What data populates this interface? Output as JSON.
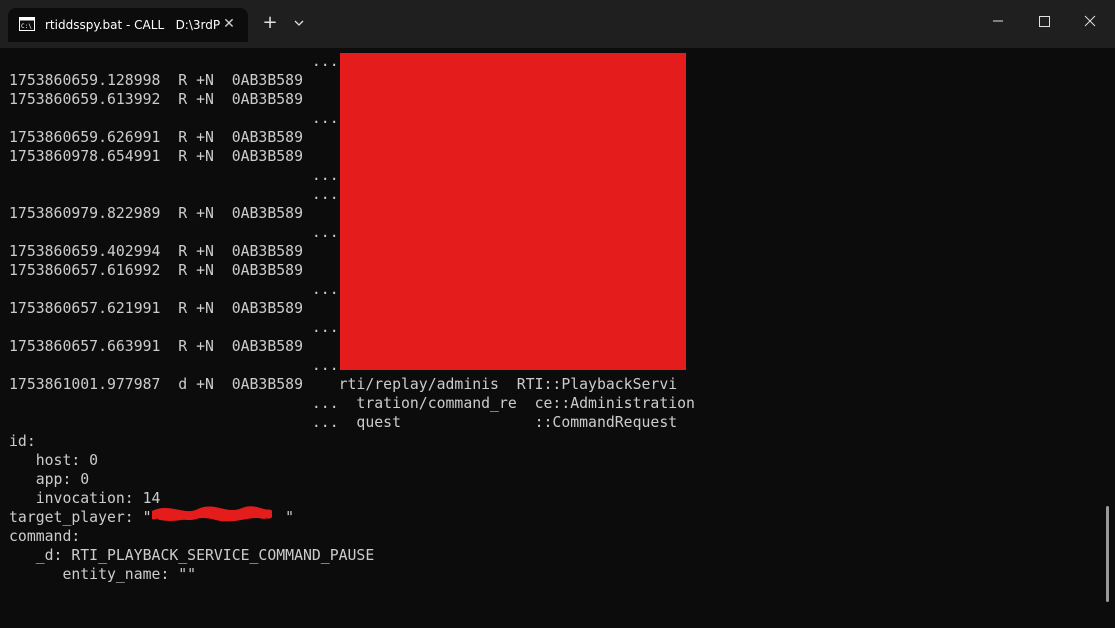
{
  "window": {
    "tab_title": "rtiddsspy.bat - CALL   D:\\3rdP",
    "tab_icon": "terminal-icon",
    "new_tab_label": "+",
    "dropdown_label": "⌄",
    "close_tab_label": "✕"
  },
  "terminal": {
    "lines": [
      "                                  ...",
      "1753860659.128998  R +N  0AB3B589",
      "1753860659.613992  R +N  0AB3B589",
      "                                  ...",
      "1753860659.626991  R +N  0AB3B589",
      "1753860978.654991  R +N  0AB3B589",
      "                                  ...",
      "                                  ...",
      "1753860979.822989  R +N  0AB3B589",
      "                                  ...",
      "1753860659.402994  R +N  0AB3B589",
      "1753860657.616992  R +N  0AB3B589",
      "                                  ...",
      "1753860657.621991  R +N  0AB3B589",
      "                                  ...",
      "1753860657.663991  R +N  0AB3B589",
      "                                  ...",
      "1753861001.977987  d +N  0AB3B589    rti/replay/adminis  RTI::PlaybackServi",
      "                                  ...  tration/command_re  ce::Administration",
      "                                  ...  quest               ::CommandRequest",
      "id:",
      "   host: 0",
      "   app: 0",
      "   invocation: 14",
      "target_player: \"               \"",
      "command:",
      "   _d: RTI_PLAYBACK_SERVICE_COMMAND_PAUSE",
      "      entity_name: \"\""
    ]
  },
  "colors": {
    "background": "#0c0c0c",
    "text": "#cccccc",
    "titlebar": "#1f1f1f",
    "redaction": "#e51c1c"
  }
}
